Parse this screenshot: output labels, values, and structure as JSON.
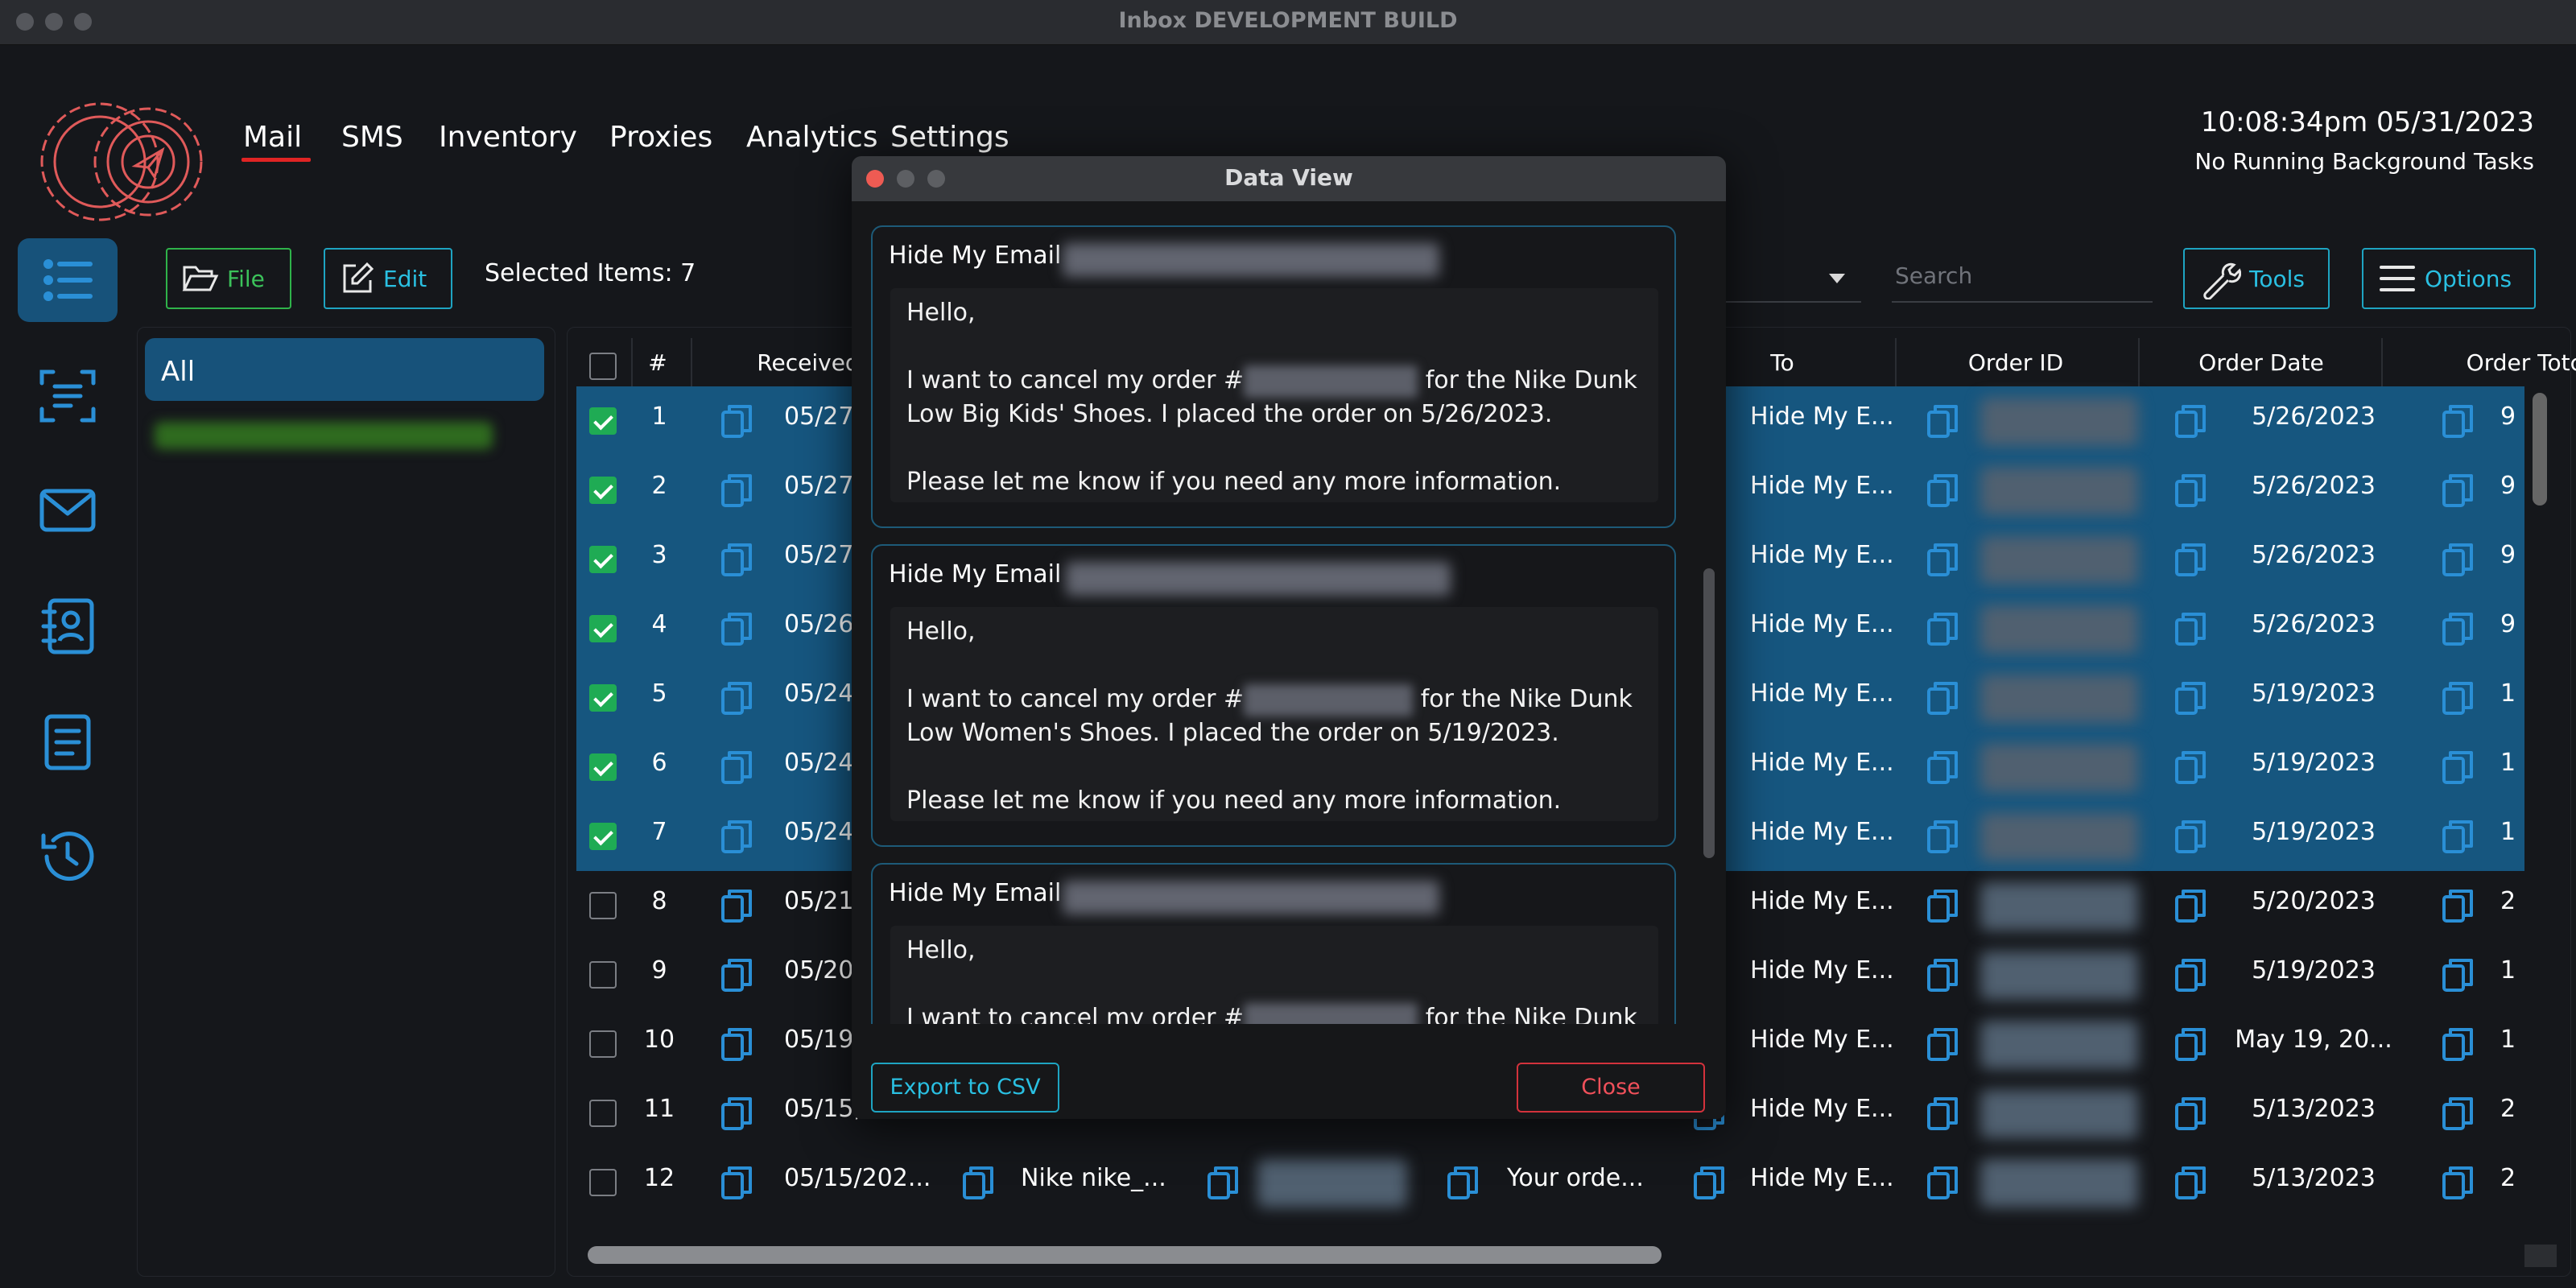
{
  "window": {
    "title": "Inbox DEVELOPMENT BUILD"
  },
  "nav": [
    "Mail",
    "SMS",
    "Inventory",
    "Proxies",
    "Analytics",
    "Settings"
  ],
  "header": {
    "clock": "10:08:34pm 05/31/2023",
    "background_status": "No Running Background Tasks"
  },
  "toolbar": {
    "file_label": "File",
    "edit_label": "Edit",
    "selected_items": "Selected Items: 7",
    "search_placeholder": "Search",
    "tools_label": "Tools",
    "options_label": "Options"
  },
  "folders": {
    "all_label": "All"
  },
  "sidebar_icons": [
    "list-icon",
    "scan-text-icon",
    "mail-icon",
    "contacts-icon",
    "document-icon",
    "history-icon"
  ],
  "table": {
    "headers": {
      "num": "#",
      "received": "Received",
      "to": "To",
      "order_id": "Order ID",
      "order_date": "Order Date",
      "order_total": "Order Totc"
    },
    "rows": [
      {
        "num": "1",
        "received": "05/27",
        "to": "Hide My E...",
        "order_date": "5/26/2023",
        "total": "9",
        "selected": true
      },
      {
        "num": "2",
        "received": "05/27",
        "to": "Hide My E...",
        "order_date": "5/26/2023",
        "total": "9",
        "selected": true
      },
      {
        "num": "3",
        "received": "05/27",
        "to": "Hide My E...",
        "order_date": "5/26/2023",
        "total": "9",
        "selected": true
      },
      {
        "num": "4",
        "received": "05/26",
        "to": "Hide My E...",
        "order_date": "5/26/2023",
        "total": "9",
        "selected": true
      },
      {
        "num": "5",
        "received": "05/24",
        "to": "Hide My E...",
        "order_date": "5/19/2023",
        "total": "1",
        "selected": true
      },
      {
        "num": "6",
        "received": "05/24",
        "to": "Hide My E...",
        "order_date": "5/19/2023",
        "total": "1",
        "selected": true
      },
      {
        "num": "7",
        "received": "05/24",
        "to": "Hide My E...",
        "order_date": "5/19/2023",
        "total": "1",
        "selected": true
      },
      {
        "num": "8",
        "received": "05/21,",
        "to": "Hide My E...",
        "order_date": "5/20/2023",
        "total": "2",
        "selected": false
      },
      {
        "num": "9",
        "received": "05/20",
        "to": "Hide My E...",
        "order_date": "5/19/2023",
        "total": "1",
        "selected": false
      },
      {
        "num": "10",
        "received": "05/19,",
        "to": "Hide My E...",
        "order_date": "May 19, 20...",
        "total": "1",
        "selected": false
      },
      {
        "num": "11",
        "received": "05/15,",
        "to": "Hide My E...",
        "order_date": "5/13/2023",
        "total": "2",
        "selected": false
      },
      {
        "num": "12",
        "received": "05/15/202...",
        "sender": "Nike nike_...",
        "subject": "Your orde...",
        "to": "Hide My E...",
        "order_date": "5/13/2023",
        "total": "2",
        "selected": false
      }
    ]
  },
  "dialog": {
    "title": "Data View",
    "cards": [
      {
        "label": "Hide My Email",
        "greeting": "Hello,",
        "line1a": "I want to cancel my order #",
        "line1b": " for the Nike Dunk",
        "line2": "Low Big Kids' Shoes. I placed the order on 5/26/2023.",
        "line3": "Please let me know if you need any more information."
      },
      {
        "label": "Hide My Email",
        "greeting": "Hello,",
        "line1a": "I want to cancel my order #",
        "line1b": " for the Nike Dunk",
        "line2": "Low Women's Shoes. I placed the order on 5/19/2023.",
        "line3": "Please let me know if you need any more information."
      },
      {
        "label": "Hide My Email",
        "greeting": "Hello,",
        "line1a": "I want to cancel my order #",
        "line1b": " for the Nike Dunk"
      }
    ],
    "export_label": "Export to CSV",
    "close_label": "Close"
  },
  "colors": {
    "accent": "#1ea4c2",
    "selected_row": "#16567f",
    "nav_underline": "#e02424",
    "checkbox": "#1fab54",
    "close_button": "#d3323c",
    "file_button": "#2fb34a"
  }
}
